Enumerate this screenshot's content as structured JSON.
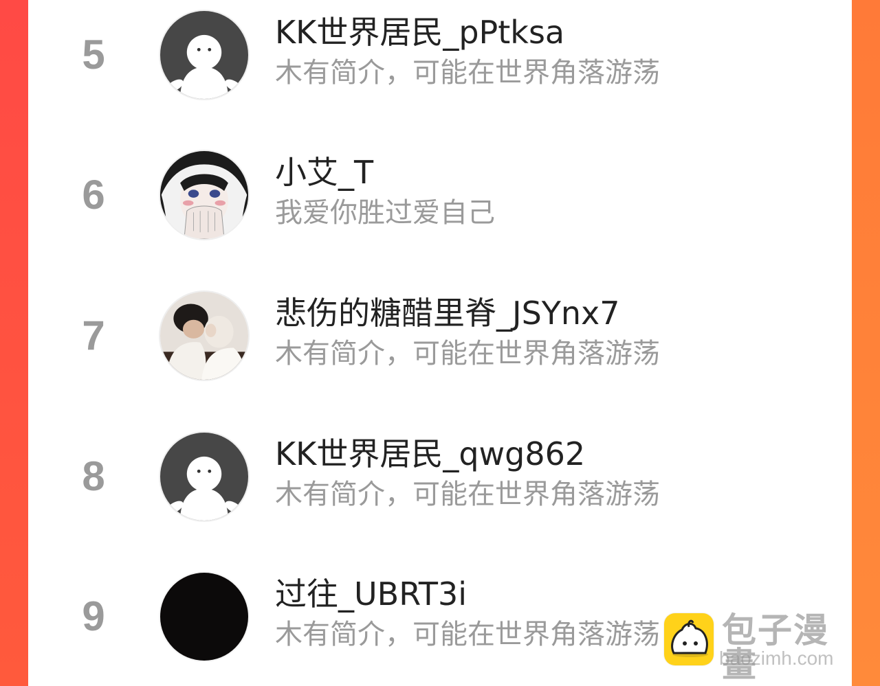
{
  "colors": {
    "frame_left": "#ff4a45",
    "frame_right": "#ff8a3a",
    "rank": "#9a9a9a",
    "name": "#222222",
    "bio": "#9a9a9a",
    "logo": "#ffd21a"
  },
  "ranking": {
    "rows": [
      {
        "rank": "5",
        "name": "KK世界居民_pPtksa",
        "bio": "木有简介，可能在世界角落游荡",
        "avatar": "default-avatar"
      },
      {
        "rank": "6",
        "name": "小艾_T",
        "bio": "我爱你胜过爱自己",
        "avatar": "anime-girl-avatar"
      },
      {
        "rank": "7",
        "name": "悲伤的糖醋里脊_JSYnx7",
        "bio": "木有简介，可能在世界角落游荡",
        "avatar": "couple-photo-avatar"
      },
      {
        "rank": "8",
        "name": "KK世界居民_qwg862",
        "bio": "木有简介，可能在世界角落游荡",
        "avatar": "default-avatar"
      },
      {
        "rank": "9",
        "name": "过往_UBRT3i",
        "bio": "木有简介，可能在世界角落游荡",
        "avatar": "black-avatar"
      }
    ]
  },
  "watermark": {
    "title": "包子漫畫",
    "url": "baozimh.com",
    "icon": "bun-logo-icon"
  }
}
